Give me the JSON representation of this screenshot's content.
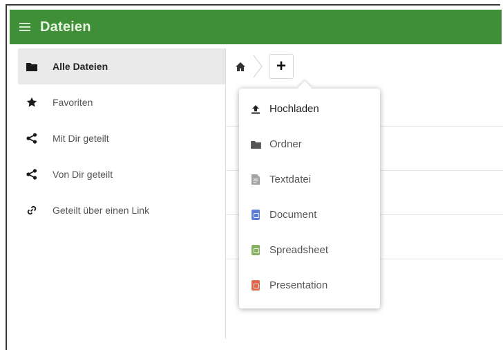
{
  "header": {
    "title": "Dateien",
    "menu_icon": "hamburger-icon",
    "color": "#3f8f39"
  },
  "sidebar": {
    "items": [
      {
        "label": "Alle Dateien",
        "icon": "folder-icon",
        "active": true
      },
      {
        "label": "Favoriten",
        "icon": "star-icon",
        "active": false
      },
      {
        "label": "Mit Dir geteilt",
        "icon": "share-icon",
        "active": false
      },
      {
        "label": "Von Dir geteilt",
        "icon": "share-icon",
        "active": false
      },
      {
        "label": "Geteilt über einen Link",
        "icon": "link-icon",
        "active": false
      }
    ]
  },
  "breadcrumb": {
    "home_icon": "home-icon",
    "add_label": "+"
  },
  "new_menu": {
    "items": [
      {
        "label": "Hochladen",
        "icon": "upload-icon",
        "color": "#222222"
      },
      {
        "label": "Ordner",
        "icon": "folder-icon",
        "color": "#555555"
      },
      {
        "label": "Textdatei",
        "icon": "text-file-icon",
        "color": "#9a9a9a"
      },
      {
        "label": "Document",
        "icon": "document-icon",
        "color": "#5b7fd6"
      },
      {
        "label": "Spreadsheet",
        "icon": "spreadsheet-icon",
        "color": "#86b05f"
      },
      {
        "label": "Presentation",
        "icon": "presentation-icon",
        "color": "#e0684a"
      }
    ]
  }
}
